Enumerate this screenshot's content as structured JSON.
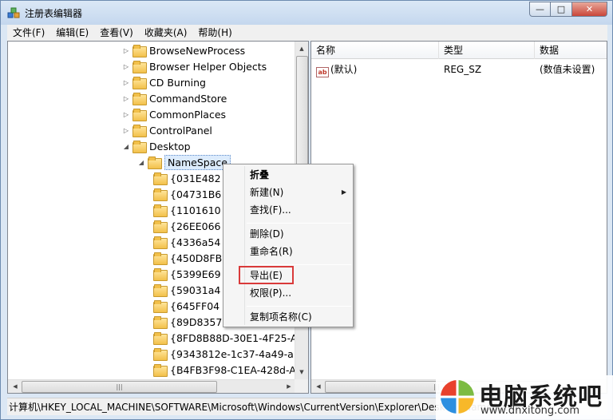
{
  "window": {
    "title": "注册表编辑器",
    "controls": {
      "minimize": "—",
      "maximize": "□",
      "close": "✕"
    }
  },
  "menubar": [
    "文件(F)",
    "编辑(E)",
    "查看(V)",
    "收藏夹(A)",
    "帮助(H)"
  ],
  "tree": {
    "items": [
      {
        "label": "BrowseNewProcess",
        "twisty": "▷"
      },
      {
        "label": "Browser Helper Objects",
        "twisty": "▷"
      },
      {
        "label": "CD Burning",
        "twisty": "▷"
      },
      {
        "label": "CommandStore",
        "twisty": "▷"
      },
      {
        "label": "CommonPlaces",
        "twisty": "▷"
      },
      {
        "label": "ControlPanel",
        "twisty": "▷"
      },
      {
        "label": "Desktop",
        "twisty": "◢"
      },
      {
        "label": "NameSpace",
        "twisty": "◢",
        "selected": true
      },
      {
        "label": "{031E482",
        "twisty": ""
      },
      {
        "label": "{04731B6",
        "twisty": ""
      },
      {
        "label": "{1101610",
        "twisty": ""
      },
      {
        "label": "{26EE066",
        "twisty": ""
      },
      {
        "label": "{4336a54",
        "twisty": ""
      },
      {
        "label": "{450D8FB",
        "twisty": ""
      },
      {
        "label": "{5399E69",
        "twisty": ""
      },
      {
        "label": "{59031a4",
        "twisty": ""
      },
      {
        "label": "{645FF04",
        "twisty": ""
      },
      {
        "label": "{89D8357",
        "twisty": ""
      },
      {
        "label": "{8FD8B88D-30E1-4F25-A",
        "twisty": ""
      },
      {
        "label": "{9343812e-1c37-4a49-a1",
        "twisty": ""
      },
      {
        "label": "{B4FB3F98-C1EA-428d-A",
        "twisty": ""
      }
    ]
  },
  "list": {
    "columns": [
      "名称",
      "类型",
      "数据"
    ],
    "rows": [
      {
        "name": "(默认)",
        "type": "REG_SZ",
        "data": "(数值未设置)",
        "icon": "ab"
      }
    ]
  },
  "context_menu": {
    "collapse": "折叠",
    "new": "新建(N)",
    "find": "查找(F)...",
    "delete": "删除(D)",
    "rename": "重命名(R)",
    "export": "导出(E)",
    "permissions": "权限(P)...",
    "copy_key_name": "复制项名称(C)"
  },
  "statusbar": {
    "path": "计算机\\HKEY_LOCAL_MACHINE\\SOFTWARE\\Microsoft\\Windows\\CurrentVersion\\Explorer\\Desktop\\NameSpace"
  },
  "watermark": {
    "title": "电脑系统吧",
    "url": "www.dnxitong.com"
  },
  "colors": {
    "highlight_border": "#d93a3a",
    "selection": "#dcebfc"
  }
}
